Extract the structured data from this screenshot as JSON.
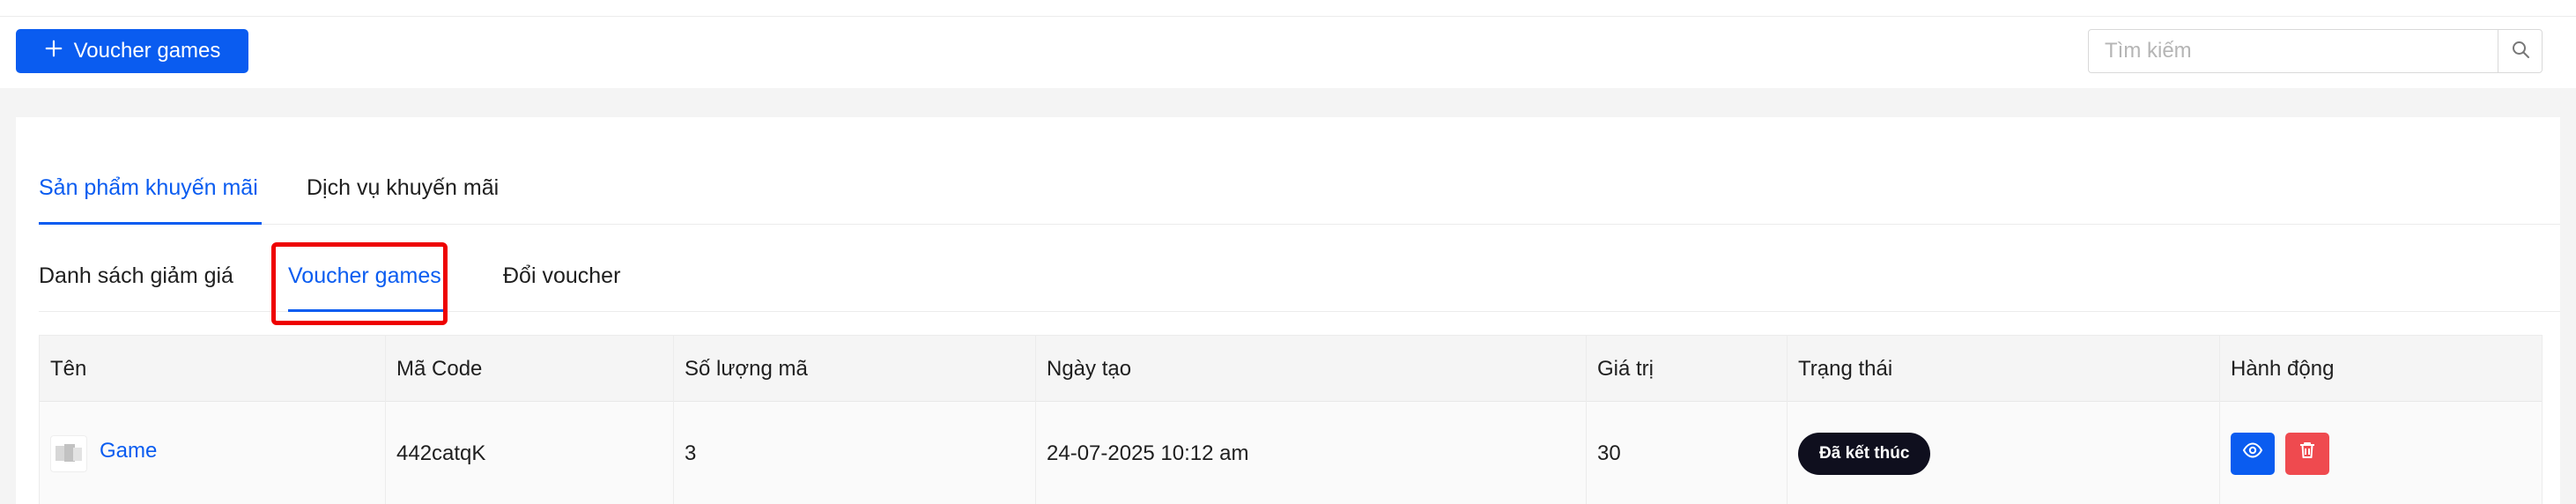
{
  "toolbar": {
    "add_button_label": "Voucher games",
    "search_placeholder": "Tìm kiếm"
  },
  "main_tabs": [
    {
      "label": "Sản phẩm khuyến mãi",
      "active": true
    },
    {
      "label": "Dịch vụ khuyến mãi",
      "active": false
    }
  ],
  "sub_tabs": [
    {
      "label": "Danh sách giảm giá",
      "active": false
    },
    {
      "label": "Voucher games",
      "active": true
    },
    {
      "label": "Đổi voucher",
      "active": false
    }
  ],
  "table": {
    "columns": [
      "Tên",
      "Mã Code",
      "Số lượng mã",
      "Ngày tạo",
      "Giá trị",
      "Trạng thái",
      "Hành động"
    ],
    "rows": [
      {
        "name": "Game",
        "code": "442catqK",
        "quantity": "3",
        "created": "24-07-2025 10:12 am",
        "value": "30",
        "status": "Đã kết thúc"
      }
    ]
  },
  "colors": {
    "primary": "#0a5cf0",
    "danger": "#ef4a4f",
    "status_badge": "#0f0f1e",
    "highlight": "#ee0000"
  },
  "icons": [
    "plus-icon",
    "search-icon",
    "game-thumbnail",
    "eye-icon",
    "trash-icon"
  ]
}
